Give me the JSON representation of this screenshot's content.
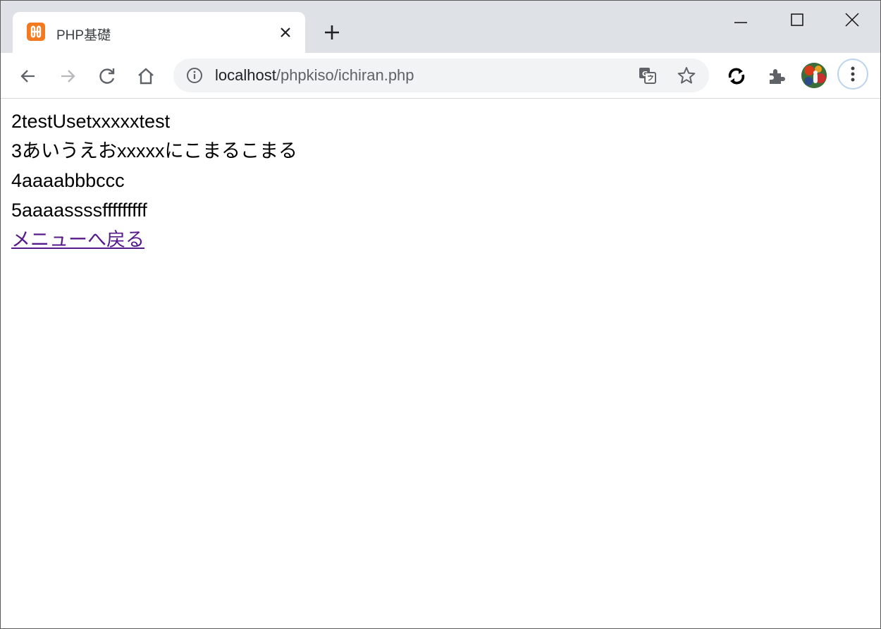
{
  "tab": {
    "title": "PHP基礎"
  },
  "address_bar": {
    "url_host": "localhost",
    "url_path": "/phpkiso/ichiran.php"
  },
  "content": {
    "rows": [
      "2testUsetxxxxxtest",
      "3あいうえおxxxxxにこまるこまる",
      "4aaaabbbccc",
      "5aaaassssfffffffff"
    ],
    "menu_link": "メニューへ戻る"
  },
  "colors": {
    "tabbar_bg": "#dee1e6",
    "omnibox_bg": "#f1f3f4",
    "favicon": "#f37a20",
    "visited_link": "#551a8b"
  },
  "icons": {
    "favicon": "xampp-icon",
    "tab_close": "close-icon",
    "new_tab": "plus-icon",
    "back": "arrow-left-icon",
    "forward": "arrow-right-icon",
    "reload": "reload-icon",
    "home": "home-icon",
    "site_info": "info-icon",
    "translate": "translate-icon",
    "bookmark": "star-icon",
    "sync": "sync-icon",
    "extensions": "puzzle-icon",
    "menu": "more-vert-icon"
  }
}
